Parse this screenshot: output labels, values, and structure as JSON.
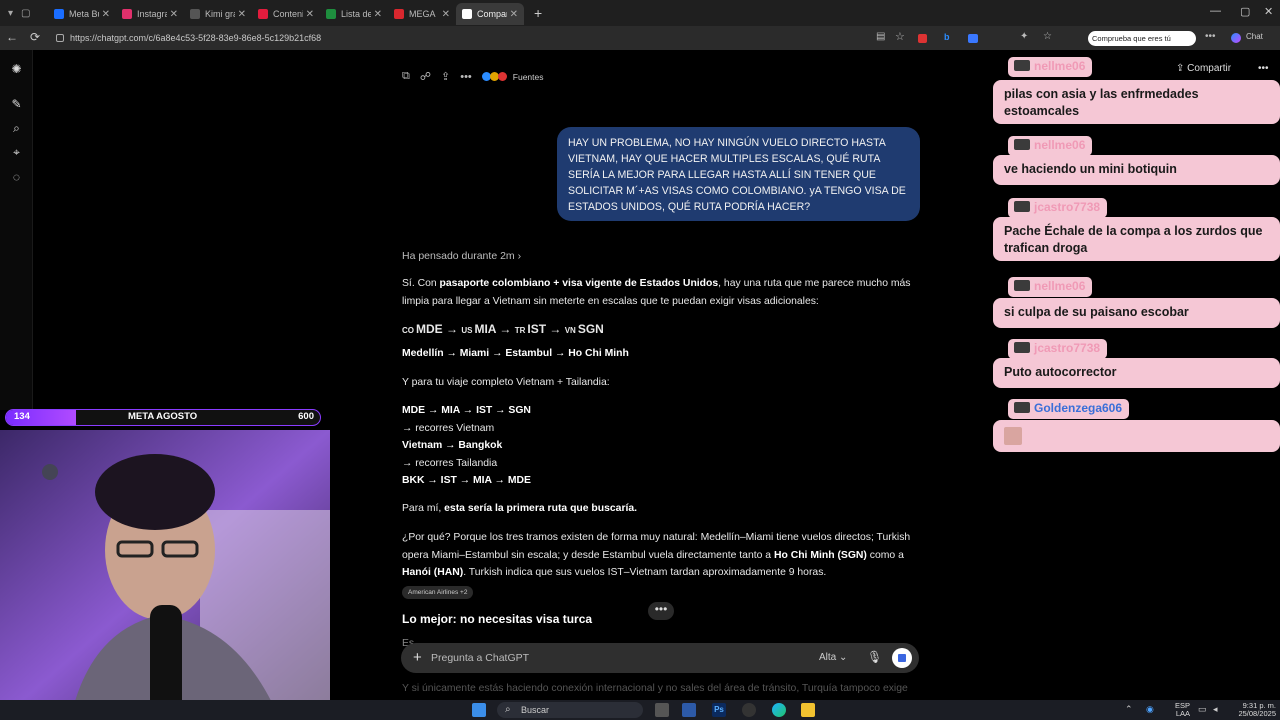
{
  "browser": {
    "tabs": [
      {
        "title": "Meta Bu",
        "color": "#1a6dff"
      },
      {
        "title": "Instagram",
        "color": "#e1306c"
      },
      {
        "title": "Kimi gra",
        "color": "#555555"
      },
      {
        "title": "Contenid",
        "color": "#e31c3d"
      },
      {
        "title": "Lista de",
        "color": "#1e8e3e"
      },
      {
        "title": "MEGA",
        "color": "#d9272e"
      },
      {
        "title": "Compar",
        "color": "#ffffff",
        "active": true
      }
    ],
    "url": "https://chatgpt.com/c/6a8e4c53-5f28-83e9-86e8-5c129b21cf68",
    "captcha_text": "Comprueba que eres tú",
    "chat_button": "Chat"
  },
  "rail_icons": [
    "openai-logo-icon",
    "new-chat-icon",
    "search-icon",
    "pin-icon",
    "chat-bubble-icon"
  ],
  "chat": {
    "sources_label": "Fuentes",
    "share_label": "Compartir",
    "user_message": "HAY UN PROBLEMA, NO HAY NINGÚN VUELO DIRECTO HASTA VIETNAM, HAY QUE HACER MULTIPLES ESCALAS, QUÉ RUTA SERÍA LA MEJOR PARA LLEGAR HASTA ALLÍ SIN TENER QUE SOLICITAR M´+AS VISAS COMO COLOMBIANO. yA TENGO VISA DE ESTADOS UNIDOS, QUÉ RUTA PODRÍA HACER?",
    "thought_label": "Ha pensado durante 2m",
    "answer": {
      "p1_a": "Sí. Con ",
      "p1_b": "pasaporte colombiano + visa vigente de Estados Unidos",
      "p1_c": ", hay una ruta que me parece mucho más limpia para llegar a Vietnam sin meterte en escalas que te puedan exigir visas adicionales:",
      "route_flags": [
        "CO",
        "US",
        "TR",
        "VN"
      ],
      "route_codes": [
        "MDE",
        "MIA",
        "IST",
        "SGN"
      ],
      "route_names": "Medellín → Miami → Estambul → Ho Chi Minh",
      "trip_intro": "Y para tu viaje completo Vietnam + Tailandia:",
      "trip_lines": [
        {
          "text": "MDE → MIA → IST → SGN",
          "bold": true
        },
        {
          "text": "→ recorres Vietnam",
          "bold": false
        },
        {
          "text": "Vietnam → Bangkok",
          "bold": true
        },
        {
          "text": "→ recorres Tailandia",
          "bold": false
        },
        {
          "text": "BKK → IST → MIA → MDE",
          "bold": true
        }
      ],
      "first_a": "Para mí, ",
      "first_b": "esta sería la primera ruta que buscaría.",
      "why_a": "¿Por qué? Porque los tres tramos existen de forma muy natural: Medellín–Miami tiene vuelos directos; Turkish opera Miami–Estambul sin escala; y desde Estambul vuela directamente tanto a ",
      "why_b": "Ho Chi Minh (SGN)",
      "why_c": " como a ",
      "why_d": "Hanói (HAN)",
      "why_e": ". Turkish indica que sus vuelos IST–Vietnam tardan aproximadamente 9 horas.",
      "source_chip": "American Airlines +2",
      "h_visa": "Lo mejor: no necesitas visa turca",
      "cut_line_1": "Es … … … … … … … … … …",
      "cut_line_2": "Y si únicamente estás haciendo conexión internacional y no sales del área de tránsito, Turquía tampoco exige"
    },
    "more_button": "•••",
    "composer": {
      "placeholder": "Pregunta a ChatGPT",
      "mode": "Alta"
    }
  },
  "goal_bar": {
    "current": "134",
    "label": "META AGOSTO",
    "target": "600",
    "progress": 0.223
  },
  "stream_chat": [
    {
      "user": "nellme06",
      "text": "pilas con asia y las enfrmedades estoamcales",
      "name_color": "#f09ab6"
    },
    {
      "user": "nellme06",
      "text": "ve haciendo un mini botiquin",
      "name_color": "#f09ab6"
    },
    {
      "user": "jcastro7738",
      "text": "Pache Échale de la compa a los zurdos que trafican droga",
      "name_color": "#f09ab6"
    },
    {
      "user": "nellme06",
      "text": "si culpa de su paisano escobar",
      "name_color": "#f09ab6"
    },
    {
      "user": "jcastro7738",
      "text": "Puto autocorrector",
      "name_color": "#f09ab6"
    },
    {
      "user": "Goldenzega606",
      "text": "",
      "name_color": "#3a6fd8"
    }
  ],
  "taskbar": {
    "search_placeholder": "Buscar",
    "lang_1": "ESP",
    "lang_2": "LAA",
    "time": "9:31 p. m.",
    "date": "25/08/2025"
  }
}
